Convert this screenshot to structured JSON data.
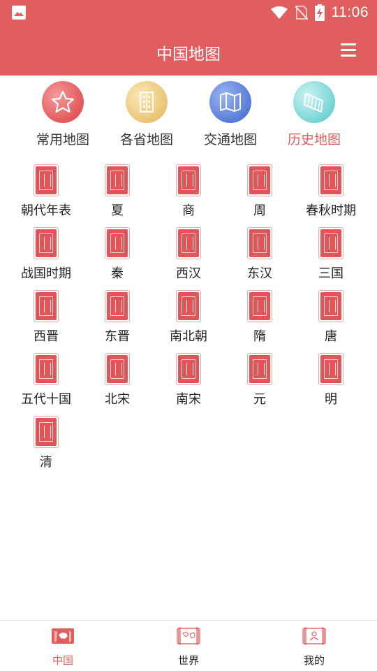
{
  "status_bar": {
    "time": "11:06",
    "icons": [
      "image-icon",
      "wifi-icon",
      "no-sim-icon",
      "battery-charging-icon"
    ]
  },
  "app_bar": {
    "title": "中国地图",
    "menu_icon": "menu-icon"
  },
  "categories": [
    {
      "label": "常用地图",
      "icon": "star-icon",
      "active": false
    },
    {
      "label": "各省地图",
      "icon": "building-icon",
      "active": false
    },
    {
      "label": "交通地图",
      "icon": "folded-map-icon",
      "active": false
    },
    {
      "label": "历史地图",
      "icon": "scroll-icon",
      "active": true
    }
  ],
  "dynasties": [
    {
      "label": "朝代年表"
    },
    {
      "label": "夏"
    },
    {
      "label": "商"
    },
    {
      "label": "周"
    },
    {
      "label": "春秋时期"
    },
    {
      "label": "战国时期"
    },
    {
      "label": "秦"
    },
    {
      "label": "西汉"
    },
    {
      "label": "东汉"
    },
    {
      "label": "三国"
    },
    {
      "label": "西晋"
    },
    {
      "label": "东晋"
    },
    {
      "label": "南北朝"
    },
    {
      "label": "隋"
    },
    {
      "label": "唐"
    },
    {
      "label": "五代十国"
    },
    {
      "label": "北宋"
    },
    {
      "label": "南宋"
    },
    {
      "label": "元"
    },
    {
      "label": "明"
    },
    {
      "label": "清"
    }
  ],
  "bottom_nav": [
    {
      "label": "中国",
      "icon": "china-map-icon",
      "active": true
    },
    {
      "label": "世界",
      "icon": "world-map-icon",
      "active": false
    },
    {
      "label": "我的",
      "icon": "profile-icon",
      "active": false
    }
  ],
  "colors": {
    "primary": "#e15e5e",
    "seal": "#e05658",
    "text": "#222222"
  }
}
